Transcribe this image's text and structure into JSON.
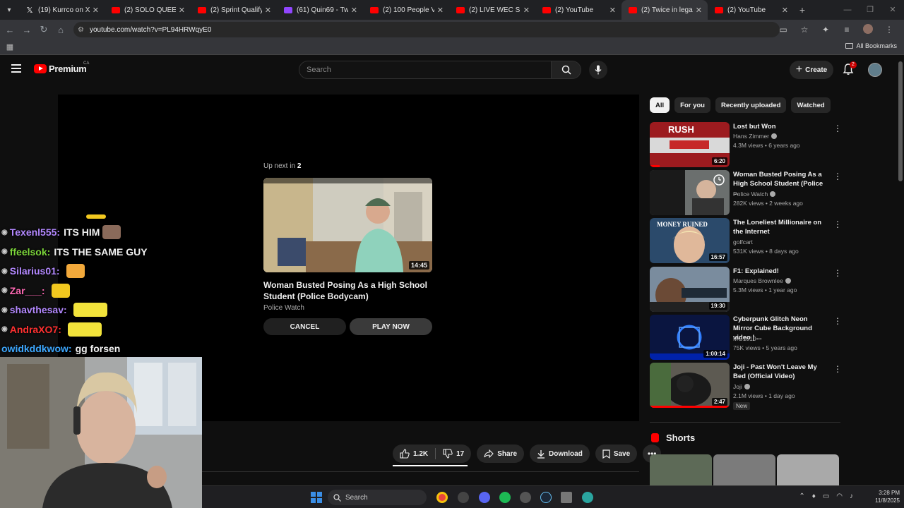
{
  "browser": {
    "tabs": [
      {
        "title": "(19) Kurrco on X: \"RE",
        "favicon": "x-icon"
      },
      {
        "title": "(2) SOLO QUEEN Bos",
        "favicon": "youtube-icon"
      },
      {
        "title": "(2) Sprint Qualifying |",
        "favicon": "youtube-icon"
      },
      {
        "title": "(61) Quin69 - Twitch",
        "favicon": "twitch-icon"
      },
      {
        "title": "(2) 100 People Vs Wo",
        "favicon": "youtube-icon"
      },
      {
        "title": "(2) LIVE WEC SEASON",
        "favicon": "youtube-icon"
      },
      {
        "title": "(2) YouTube",
        "favicon": "youtube-icon"
      },
      {
        "title": "(2) Twice in legal min",
        "favicon": "youtube-icon",
        "active": true
      },
      {
        "title": "(2) YouTube",
        "favicon": "youtube-icon"
      }
    ],
    "url": "youtube.com/watch?v=PL94HRWqyE0",
    "bookmarks_all": "All Bookmarks"
  },
  "header": {
    "logo_text": "Premium",
    "country_code": "CA",
    "search_placeholder": "Search",
    "create_label": "Create",
    "notifications_count": "2"
  },
  "player": {
    "upnext_prefix": "Up next in",
    "upnext_countdown": "2",
    "upnext_title": "Woman Busted Posing As a High School Student (Police Bodycam)",
    "upnext_channel": "Police Watch",
    "upnext_duration": "14:45",
    "cancel_label": "CANCEL",
    "play_now_label": "PLAY NOW"
  },
  "actions": {
    "likes": "1.2K",
    "dislikes": "17",
    "share": "Share",
    "download": "Download",
    "save": "Save"
  },
  "chat": [
    {
      "user": "Texenl555",
      "message": "ITS HIM",
      "color": "#b388ff"
    },
    {
      "user": "ffeelsok",
      "message": "ITS THE SAME GUY",
      "color": "#7cd63a"
    },
    {
      "user": "Silarius01",
      "message": "",
      "color": "#b388ff"
    },
    {
      "user": "Zar___",
      "message": "",
      "color": "#ff69b4"
    },
    {
      "user": "shavthesav",
      "message": "",
      "color": "#b388ff"
    },
    {
      "user": "AndraXO7",
      "message": "",
      "color": "#ff3030"
    },
    {
      "user": "owidkddkwow",
      "message": "gg forsen",
      "color": "#3da8ff"
    }
  ],
  "sidebar": {
    "chips": [
      "All",
      "For you",
      "Recently uploaded",
      "Watched"
    ],
    "recommendations": [
      {
        "title": "Lost but Won",
        "channel": "Hans Zimmer",
        "stats": "4.3M views • 6 years ago",
        "duration": "6:20",
        "verified": true,
        "watched": 0.12
      },
      {
        "title": "Woman Busted Posing As a High School Student (Police ...",
        "channel": "Police Watch",
        "stats": "282K views • 2 weeks ago",
        "duration": "",
        "verified": true,
        "watched": 0
      },
      {
        "title": "The Loneliest Millionaire on the Internet",
        "channel": "golfcart",
        "stats": "531K views • 8 days ago",
        "duration": "16:57",
        "verified": false,
        "watched": 0
      },
      {
        "title": "F1: Explained!",
        "channel": "Marques Brownlee",
        "stats": "5.3M views • 1 year ago",
        "duration": "19:30",
        "verified": true,
        "watched": 0
      },
      {
        "title": "Cyberpunk Glitch Neon Mirror Cube Background video | ...",
        "channel": "MG1010",
        "stats": "75K views • 5 years ago",
        "duration": "1:00:14",
        "verified": false,
        "watched": 0
      },
      {
        "title": "Joji - Past Won't Leave My Bed (Official Video)",
        "channel": "Joji",
        "stats": "2.1M views • 1 day ago",
        "duration": "2:47",
        "verified": true,
        "watched": 1,
        "badge": "New"
      }
    ],
    "shorts_title": "Shorts"
  },
  "taskbar": {
    "search_label": "Search",
    "time": "3:28 PM",
    "date": "11/8/2025"
  }
}
